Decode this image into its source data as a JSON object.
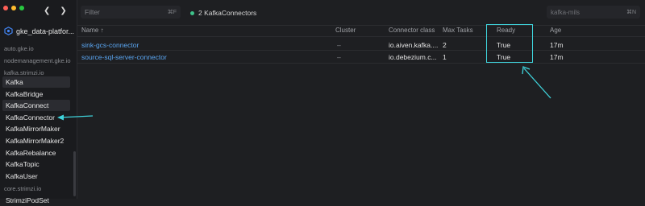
{
  "window": {
    "traffic_lights": {
      "close": "#fe5f57",
      "minimize": "#febc2e",
      "maximize": "#28c840"
    },
    "back_icon": "chevron-left-icon",
    "forward_icon": "chevron-right-icon"
  },
  "sidebar": {
    "cluster_name": "gke_data-platfor...",
    "groups": {
      "auto_gke": "auto.gke.io",
      "node_mgmt": "nodemanagement.gke.io",
      "kafka_strimzi": "kafka.strimzi.io",
      "core_strimzi": "core.strimzi.io"
    },
    "items": [
      {
        "label": "Kafka"
      },
      {
        "label": "KafkaBridge"
      },
      {
        "label": "KafkaConnect"
      },
      {
        "label": "KafkaConnector"
      },
      {
        "label": "KafkaMirrorMaker"
      },
      {
        "label": "KafkaMirrorMaker2"
      },
      {
        "label": "KafkaRebalance"
      },
      {
        "label": "KafkaTopic"
      },
      {
        "label": "KafkaUser"
      }
    ],
    "cut_off_item": "StrimziPodSet"
  },
  "toolbar": {
    "filter_placeholder": "Filter",
    "filter_shortcut": "⌘F",
    "resource_count": "2 KafkaConnectors",
    "namespace_placeholder": "kafka-mils",
    "namespace_shortcut": "⌘N"
  },
  "table": {
    "headers": {
      "name": "Name ↑",
      "cluster": "Cluster",
      "connector_class": "Connector class",
      "max_tasks": "Max Tasks",
      "ready": "Ready",
      "age": "Age"
    },
    "rows": [
      {
        "name": "sink-gcs-connector",
        "cluster": "–",
        "connector_class": "io.aiven.kafka....",
        "max_tasks": "2",
        "ready": "True",
        "age": "17m"
      },
      {
        "name": "source-sql-server-connector",
        "cluster": "–",
        "connector_class": "io.debezium.c...",
        "max_tasks": "1",
        "ready": "True",
        "age": "17m"
      }
    ]
  },
  "annotations": {
    "color": "#3fd4dc"
  }
}
